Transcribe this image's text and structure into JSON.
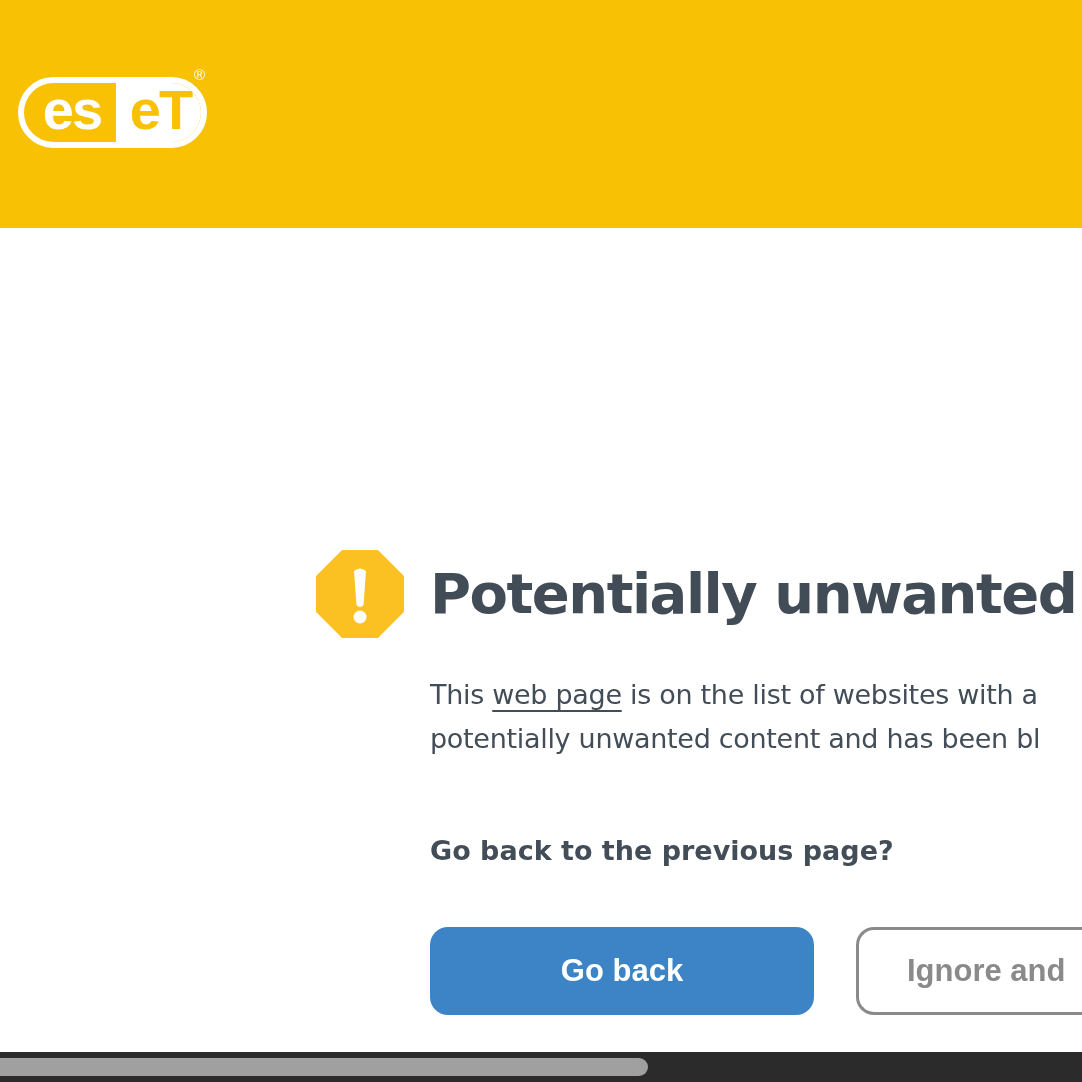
{
  "header": {
    "logo": {
      "left": "es",
      "right": "eT",
      "registered": "®"
    }
  },
  "alert": {
    "title": "Potentially unwanted",
    "description": {
      "before": "This ",
      "link": "web page",
      "after": " is on the list of websites with a\npotentially unwanted content and has been bl"
    },
    "question": "Go back to the previous page?",
    "buttons": [
      {
        "label": "Go back",
        "kind": "primary"
      },
      {
        "label": "Ignore and",
        "kind": "secondary"
      }
    ]
  }
}
